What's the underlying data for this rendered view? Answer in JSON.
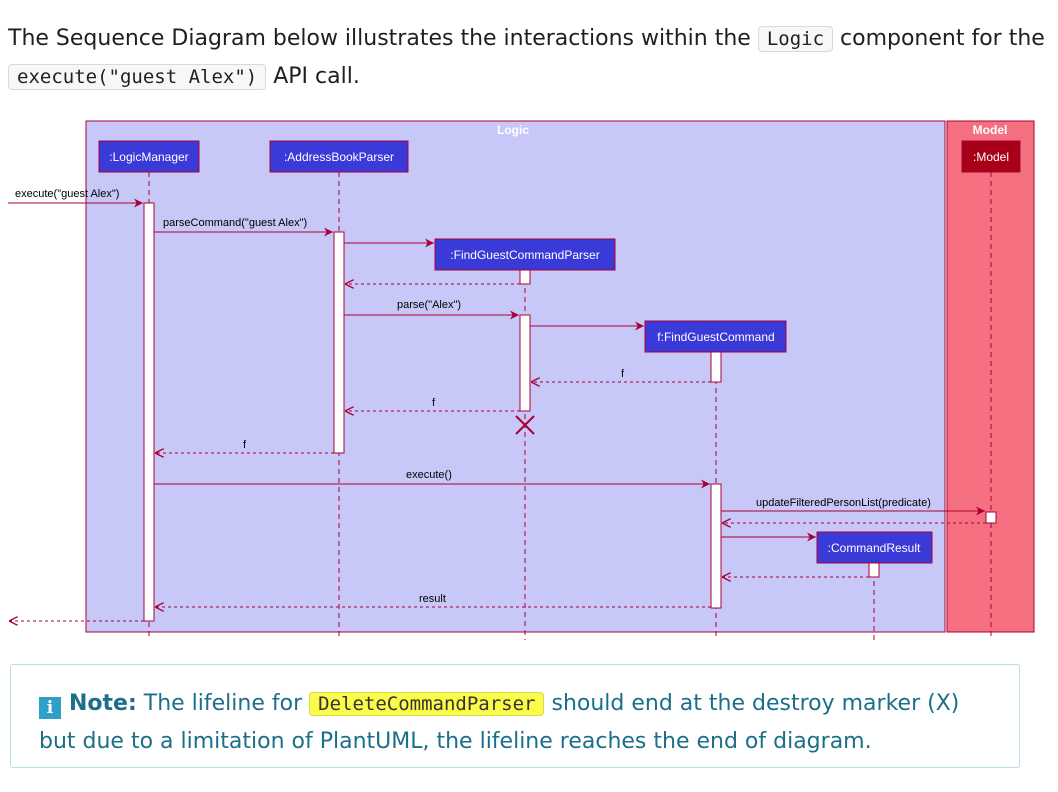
{
  "intro": {
    "text_before": "The Sequence Diagram below illustrates the interactions within the",
    "code_component": "Logic",
    "text_middle": "component for the",
    "code_call": "execute(\"guest Alex\")",
    "text_after": "API call."
  },
  "diagram": {
    "logic_frame_title": "Logic",
    "model_frame_title": "Model",
    "participants": {
      "logic_manager": ":LogicManager",
      "address_book_parser": ":AddressBookParser",
      "find_guest_command_parser": ":FindGuestCommandParser",
      "find_guest_command": "f:FindGuestCommand",
      "command_result": ":CommandResult",
      "model": ":Model"
    },
    "messages": {
      "execute_call": "execute(\"guest Alex\")",
      "parse_command": "parseCommand(\"guest Alex\")",
      "parse": "parse(\"Alex\")",
      "return_f_1": "f",
      "return_f_2": "f",
      "return_f_3": "f",
      "execute": "execute()",
      "update_filtered": "updateFilteredPersonList(predicate)",
      "result": "result"
    },
    "colors": {
      "logic_bg": "#c8c8f8",
      "model_bg": "#f47080",
      "participant_fill": "#3a3ad8",
      "model_participant_fill": "#a80018",
      "arrow": "#a80036"
    }
  },
  "note": {
    "icon": "info-icon",
    "label": "Note:",
    "text_before": "The lifeline for",
    "code": "DeleteCommandParser",
    "text_after": "should end at the destroy marker (X) but due to a limitation of PlantUML, the lifeline reaches the end of diagram."
  }
}
